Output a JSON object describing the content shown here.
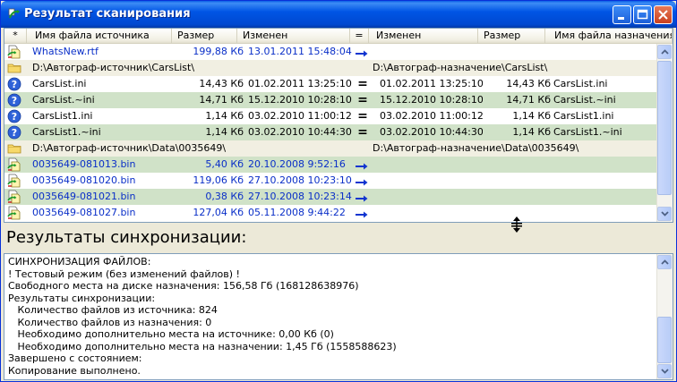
{
  "window": {
    "title": "Результат сканирования"
  },
  "columns": [
    {
      "label": "*"
    },
    {
      "label": "Имя файла источника"
    },
    {
      "label": "Размер"
    },
    {
      "label": "Изменен"
    },
    {
      "label": "="
    },
    {
      "label": "Изменен"
    },
    {
      "label": "Размер"
    },
    {
      "label": "Имя файла назначения"
    }
  ],
  "rows": [
    {
      "kind": "file",
      "icon": "file-copy-icon",
      "style": "w",
      "blue": true,
      "src_name": "WhatsNew.rtf",
      "src_size": "199,88 Кб",
      "src_date": "13.01.2011 15:48:04",
      "op": "arrow",
      "dst_date": "",
      "dst_size": "",
      "dst_name": ""
    },
    {
      "kind": "dir",
      "icon": "folder-icon",
      "src_path": "D:\\Автограф-источник\\CarsList\\",
      "dst_path": "D:\\Автограф-назначение\\CarsList\\"
    },
    {
      "kind": "file",
      "icon": "question-icon",
      "style": "w",
      "blue": false,
      "src_name": "CarsList.ini",
      "src_size": "14,43 Кб",
      "src_date": "01.02.2011 13:25:10",
      "op": "=",
      "dst_date": "01.02.2011 13:25:10",
      "dst_size": "14,43 Кб",
      "dst_name": "CarsList.ini"
    },
    {
      "kind": "file",
      "icon": "question-icon",
      "style": "g",
      "blue": false,
      "src_name": "CarsList.~ini",
      "src_size": "14,71 Кб",
      "src_date": "15.12.2010 10:28:10",
      "op": "=",
      "dst_date": "15.12.2010 10:28:10",
      "dst_size": "14,71 Кб",
      "dst_name": "CarsList.~ini"
    },
    {
      "kind": "file",
      "icon": "question-icon",
      "style": "w",
      "blue": false,
      "src_name": "CarsList1.ini",
      "src_size": "1,14 Кб",
      "src_date": "03.02.2010 11:00:12",
      "op": "=",
      "dst_date": "03.02.2010 11:00:12",
      "dst_size": "1,14 Кб",
      "dst_name": "CarsList1.ini"
    },
    {
      "kind": "file",
      "icon": "question-icon",
      "style": "g",
      "blue": false,
      "src_name": "CarsList1.~ini",
      "src_size": "1,14 Кб",
      "src_date": "03.02.2010 10:44:30",
      "op": "=",
      "dst_date": "03.02.2010 10:44:30",
      "dst_size": "1,14 Кб",
      "dst_name": "CarsList1.~ini"
    },
    {
      "kind": "dir",
      "icon": "folder-icon",
      "src_path": "D:\\Автограф-источник\\Data\\0035649\\",
      "dst_path": "D:\\Автограф-назначение\\Data\\0035649\\"
    },
    {
      "kind": "file",
      "icon": "file-copy-icon",
      "style": "g",
      "blue": true,
      "src_name": "0035649-081013.bin",
      "src_size": "5,40 Кб",
      "src_date": "20.10.2008 9:52:16",
      "op": "arrow",
      "dst_date": "",
      "dst_size": "",
      "dst_name": ""
    },
    {
      "kind": "file",
      "icon": "file-copy-icon",
      "style": "w",
      "blue": true,
      "src_name": "0035649-081020.bin",
      "src_size": "119,06 Кб",
      "src_date": "27.10.2008 10:23:10",
      "op": "arrow",
      "dst_date": "",
      "dst_size": "",
      "dst_name": ""
    },
    {
      "kind": "file",
      "icon": "file-copy-icon",
      "style": "g",
      "blue": true,
      "src_name": "0035649-081021.bin",
      "src_size": "0,38 Кб",
      "src_date": "27.10.2008 10:23:14",
      "op": "arrow",
      "dst_date": "",
      "dst_size": "",
      "dst_name": ""
    },
    {
      "kind": "file",
      "icon": "file-copy-icon",
      "style": "w",
      "blue": true,
      "src_name": "0035649-081027.bin",
      "src_size": "127,04 Кб",
      "src_date": "05.11.2008 9:44:22",
      "op": "arrow",
      "dst_date": "",
      "dst_size": "",
      "dst_name": ""
    }
  ],
  "results": {
    "heading": "Результаты синхронизации:",
    "lines": [
      "СИНХРОНИЗАЦИЯ ФАЙЛОВ:",
      "! Тестовый режим (без изменений файлов) !",
      "Свободного места на диске назначения: 156,58 Гб (168128638976)",
      "Результаты синхронизации:",
      "   Количество файлов из источника: 824",
      "   Количество файлов из назначения: 0",
      "   Необходимо дополнительно места на источнике: 0,00 Кб (0)",
      "   Необходимо дополнительно места на назначении: 1,45 Гб (1558588623)",
      "Завершено с состоянием:",
      "Копирование выполнено."
    ]
  },
  "colors": {
    "title_bar": "#0055e5",
    "row_green": "#d0e2c8",
    "link_blue": "#0a2fc8"
  }
}
